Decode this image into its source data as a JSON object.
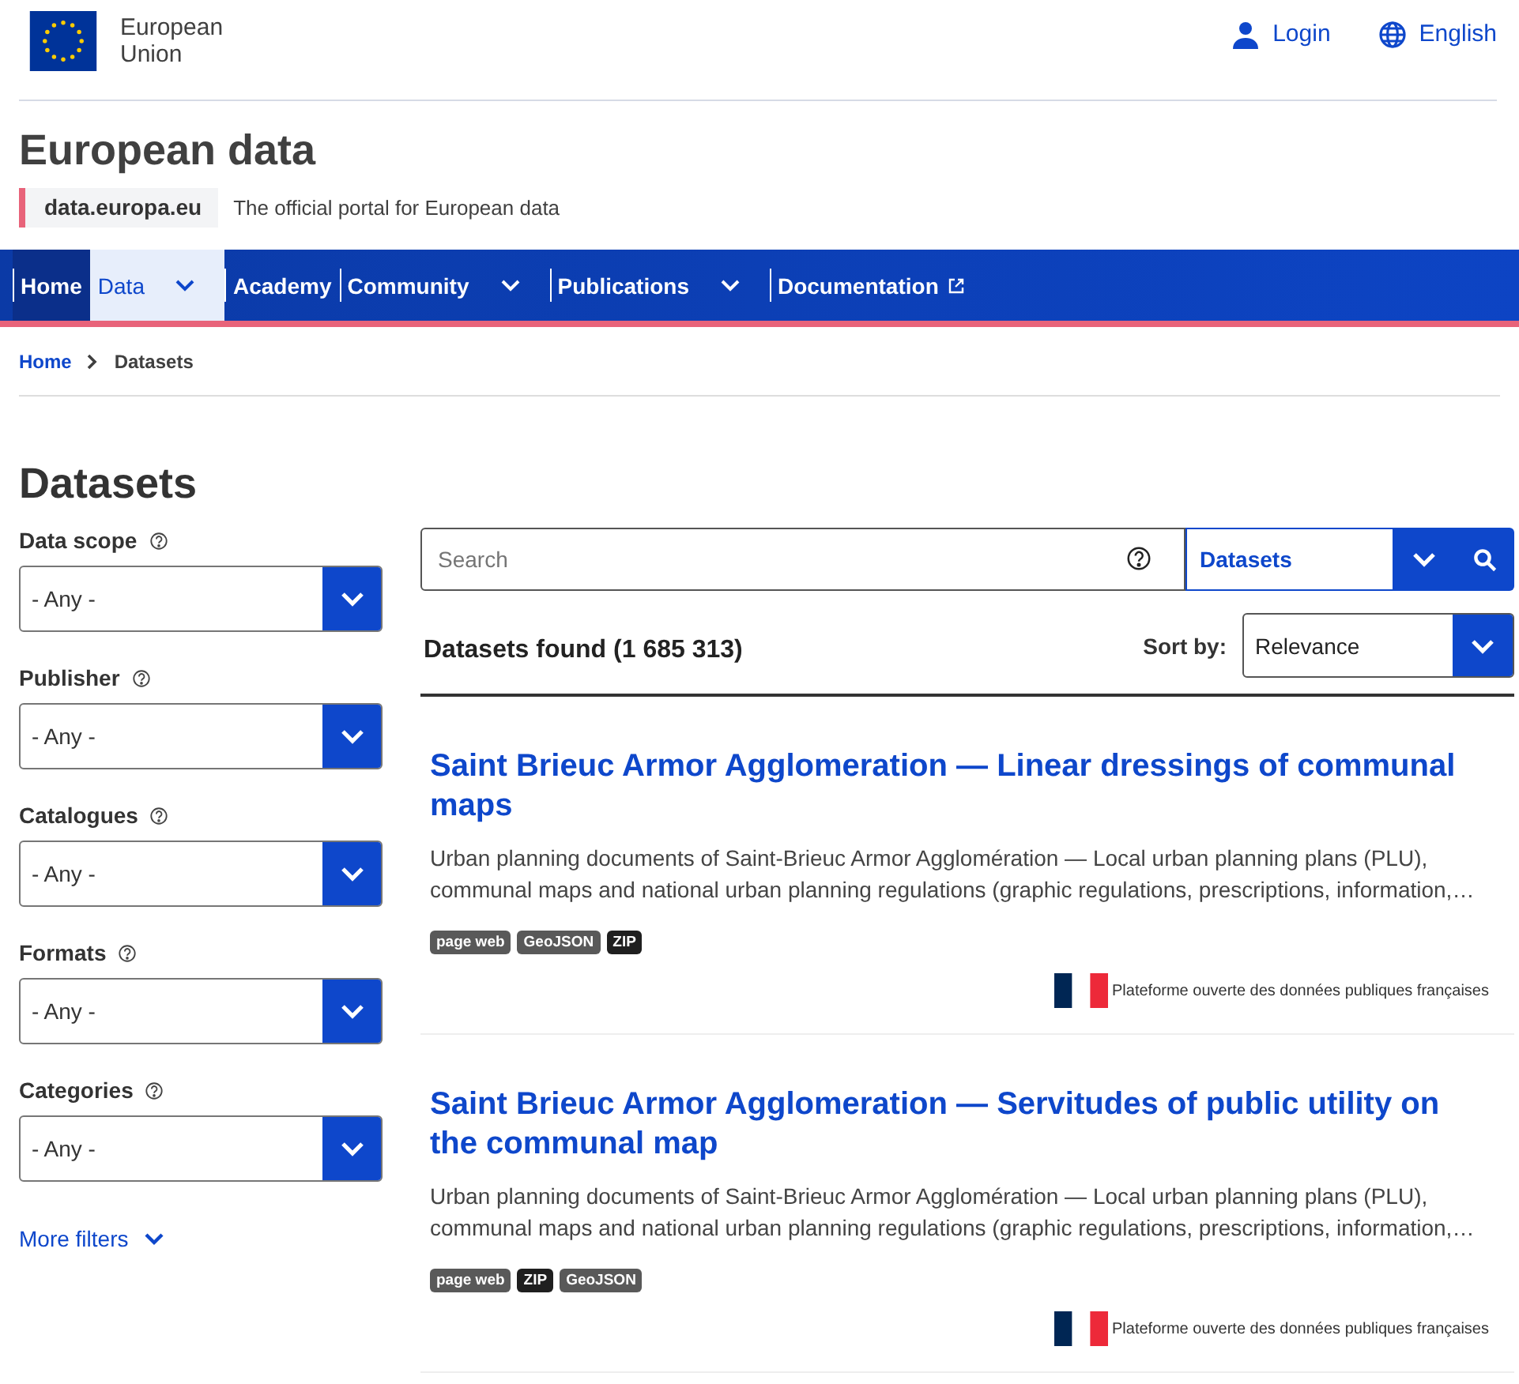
{
  "header": {
    "logo_text": "European Union",
    "login": "Login",
    "language": "English"
  },
  "site": {
    "title": "European data",
    "domain": "data.europa.eu",
    "tagline": "The official portal for European data"
  },
  "nav": [
    {
      "label": "Home",
      "kind": "link",
      "selected": false,
      "current": true
    },
    {
      "label": "Data",
      "kind": "dropdown",
      "selected": true,
      "current": false
    },
    {
      "label": "Academy",
      "kind": "link",
      "selected": false,
      "current": false
    },
    {
      "label": "Community",
      "kind": "dropdown",
      "selected": false,
      "current": false
    },
    {
      "label": "Publications",
      "kind": "dropdown",
      "selected": false,
      "current": false
    },
    {
      "label": "Documentation",
      "kind": "external",
      "selected": false,
      "current": false
    }
  ],
  "breadcrumb": [
    "Home",
    "Datasets"
  ],
  "page_title": "Datasets",
  "filters": [
    {
      "label": "Data scope",
      "value": "- Any -"
    },
    {
      "label": "Publisher",
      "value": "- Any -"
    },
    {
      "label": "Catalogues",
      "value": "- Any -"
    },
    {
      "label": "Formats",
      "value": "- Any -"
    },
    {
      "label": "Categories",
      "value": "- Any -"
    }
  ],
  "more_filters": "More filters",
  "search": {
    "placeholder": "Search",
    "scope": "Datasets"
  },
  "results_count": "Datasets found (1 685 313)",
  "sort": {
    "label": "Sort by:",
    "value": "Relevance"
  },
  "results": [
    {
      "title": "Saint Brieuc Armor Agglomeration — Linear dressings of communal maps",
      "description": "Urban planning documents of Saint-Brieuc Armor Agglomération — Local urban planning plans (PLU), communal maps and national urban planning regulations (graphic regulations, prescriptions, information,…",
      "tags": [
        {
          "label": "page web",
          "color": "#595959"
        },
        {
          "label": "GeoJSON",
          "color": "#595959"
        },
        {
          "label": "ZIP",
          "color": "#1f1f1f"
        }
      ],
      "source": "Plateforme ouverte des données publiques françaises"
    },
    {
      "title": "Saint Brieuc Armor Agglomeration — Servitudes of public utility on the communal map",
      "description": "Urban planning documents of Saint-Brieuc Armor Agglomération — Local urban planning plans (PLU), communal maps and national urban planning regulations (graphic regulations, prescriptions, information,…",
      "tags": [
        {
          "label": "page web",
          "color": "#595959"
        },
        {
          "label": "ZIP",
          "color": "#1f1f1f"
        },
        {
          "label": "GeoJSON",
          "color": "#595959"
        }
      ],
      "source": "Plateforme ouverte des données publiques françaises"
    }
  ]
}
